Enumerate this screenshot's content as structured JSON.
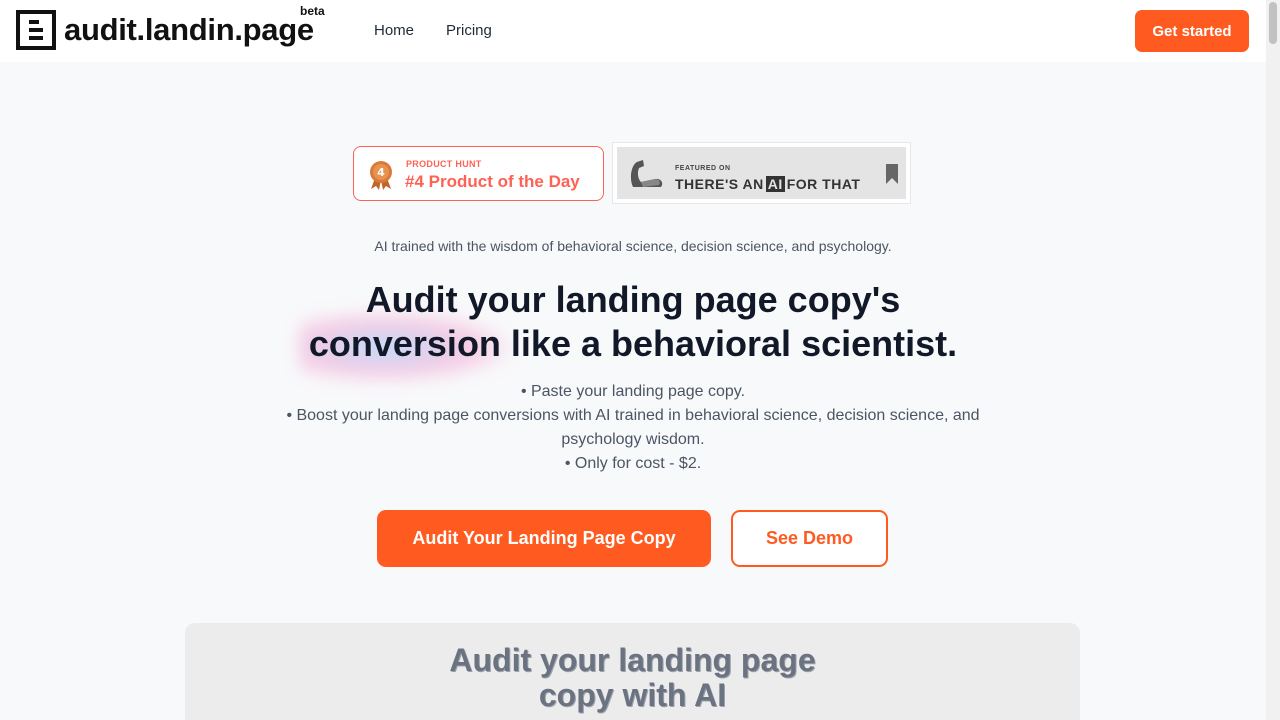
{
  "header": {
    "logo_text": "audit.landin.page",
    "beta_label": "beta",
    "nav": [
      {
        "label": "Home"
      },
      {
        "label": "Pricing"
      }
    ],
    "cta_label": "Get started"
  },
  "badges": {
    "product_hunt": {
      "small": "PRODUCT HUNT",
      "big": "#4 Product of the Day",
      "medal_number": "4"
    },
    "aift": {
      "small": "FEATURED ON",
      "part1": "THERE'S AN",
      "part_ai": "AI",
      "part2": "FOR THAT"
    }
  },
  "hero": {
    "tagline": "AI trained with the wisdom of behavioral science, decision science, and psychology.",
    "headline_line1": "Audit your landing page copy's",
    "headline_line2": "conversion like a behavioral scientist.",
    "bullets": [
      "• Paste your landing page copy.",
      "• Boost your landing page conversions with AI trained in behavioral science, decision science, and psychology wisdom.",
      "• Only for cost - $2."
    ],
    "primary_button": "Audit Your Landing Page Copy",
    "secondary_button": "See Demo"
  },
  "preview": {
    "title_line1": "Audit your landing page",
    "title_line2": "copy with AI"
  },
  "colors": {
    "accent": "#ff5a1f",
    "product_hunt": "#ff6154"
  }
}
